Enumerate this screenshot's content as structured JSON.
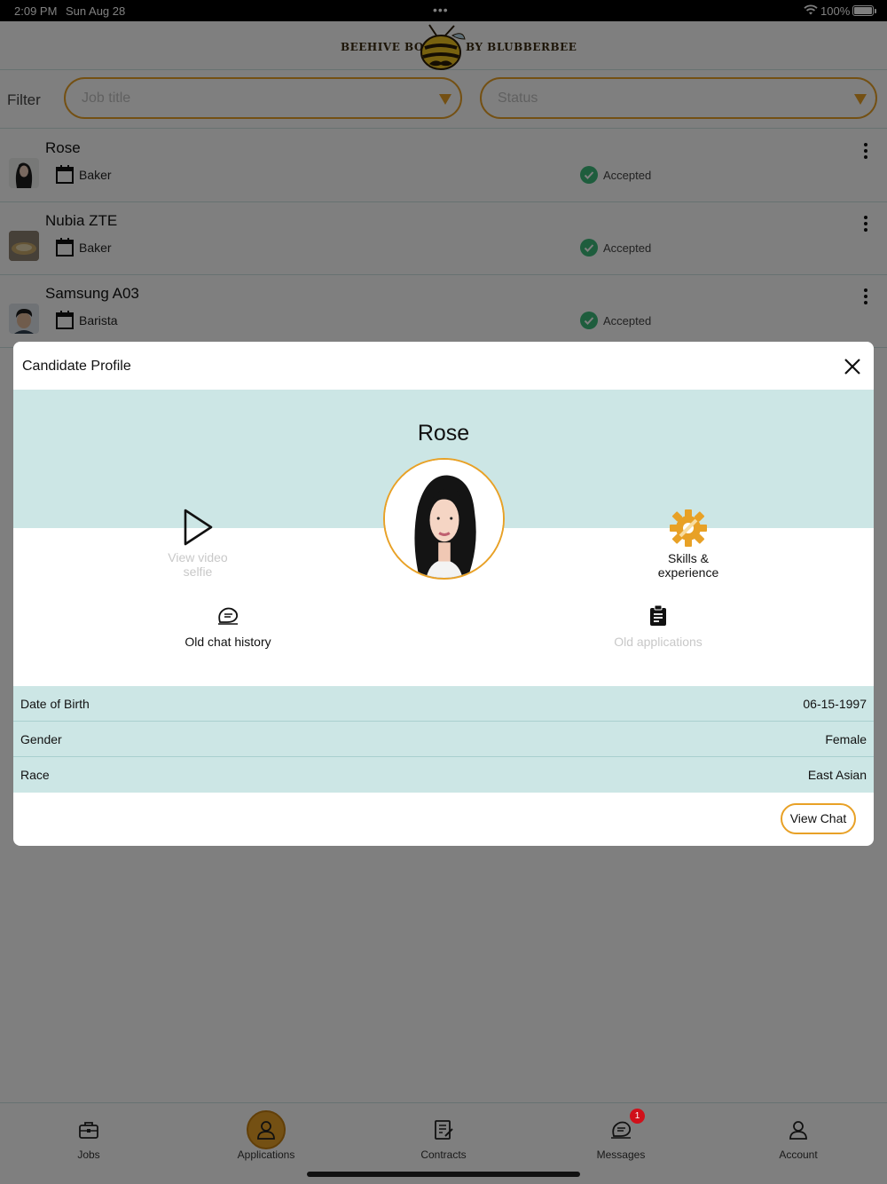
{
  "status_bar": {
    "time": "2:09 PM",
    "date": "Sun Aug 28",
    "battery": "100%"
  },
  "header": {
    "logo_left": "BEEHIVE BOSS",
    "logo_right": "BY BLUBBERBEE"
  },
  "filter": {
    "label": "Filter",
    "job_title_placeholder": "Job title",
    "status_placeholder": "Status"
  },
  "applications": [
    {
      "name": "Rose",
      "job": "Baker",
      "status": "Accepted"
    },
    {
      "name": "Nubia ZTE",
      "job": "Baker",
      "status": "Accepted"
    },
    {
      "name": "Samsung A03",
      "job": "Barista",
      "status": "Accepted"
    }
  ],
  "modal": {
    "title": "Candidate Profile",
    "candidate_name": "Rose",
    "actions": {
      "video_selfie": "View video selfie",
      "skills": "Skills & experience",
      "chat_history": "Old chat history",
      "old_applications": "Old applications"
    },
    "details": [
      {
        "key": "Date of Birth",
        "value": "06-15-1997"
      },
      {
        "key": "Gender",
        "value": "Female"
      },
      {
        "key": "Race",
        "value": "East Asian"
      }
    ],
    "view_chat_label": "View Chat"
  },
  "tabs": [
    {
      "label": "Jobs",
      "icon": "briefcase-icon"
    },
    {
      "label": "Applications",
      "icon": "person-icon",
      "active": true
    },
    {
      "label": "Contracts",
      "icon": "contract-icon"
    },
    {
      "label": "Messages",
      "icon": "chat-icon",
      "badge": "1"
    },
    {
      "label": "Account",
      "icon": "account-icon"
    }
  ],
  "colors": {
    "accent": "#e8a126",
    "teal": "#cce6e5",
    "success": "#3dbb7a",
    "badge": "#d0101a"
  }
}
